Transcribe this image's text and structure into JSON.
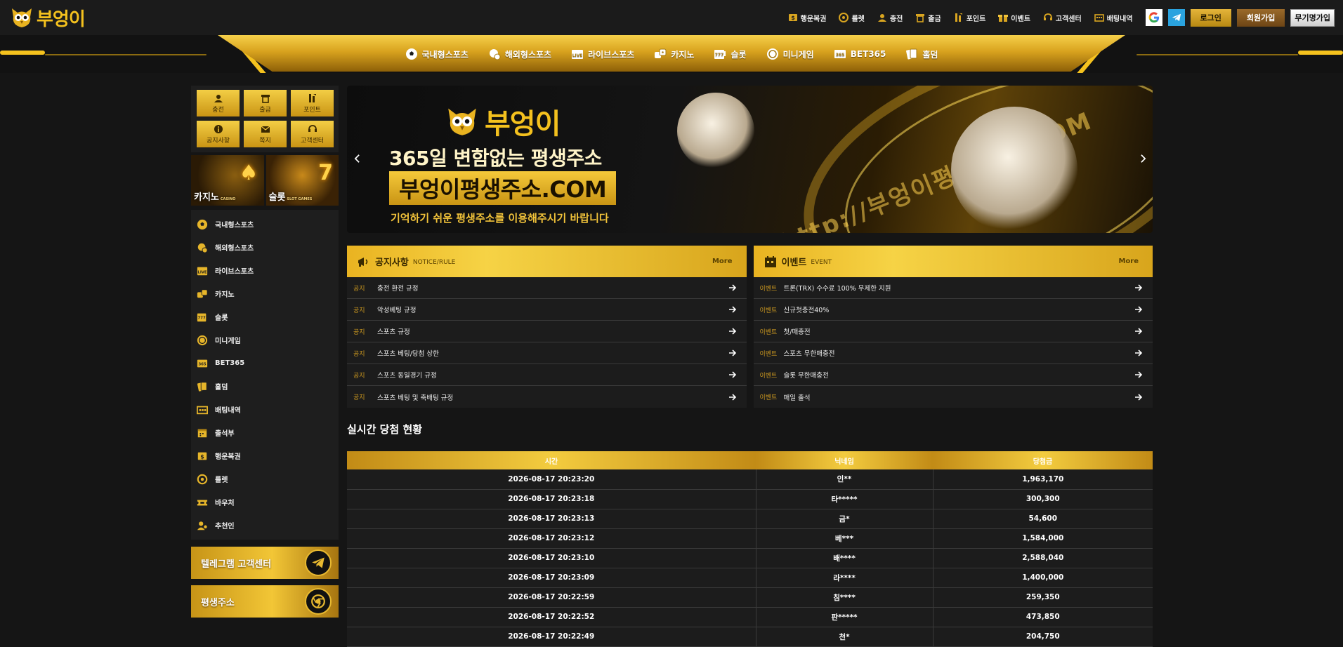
{
  "brand": {
    "name": "부엉이",
    "accent": "#f4c11e"
  },
  "header": {
    "menu": [
      {
        "label": "행운복권",
        "icon": "lottery-icon"
      },
      {
        "label": "룰렛",
        "icon": "roulette-icon"
      },
      {
        "label": "충전",
        "icon": "deposit-icon"
      },
      {
        "label": "출금",
        "icon": "withdraw-icon"
      },
      {
        "label": "포인트",
        "icon": "point-icon"
      },
      {
        "label": "이벤트",
        "icon": "gift-icon"
      },
      {
        "label": "고객센터",
        "icon": "support-icon"
      },
      {
        "label": "배팅내역",
        "icon": "history-icon"
      }
    ],
    "login_label": "로그인",
    "join_label": "회원가입",
    "free_label": "무기명가입"
  },
  "nav": [
    {
      "label": "국내형스포츠",
      "icon": "soccer-ball-icon"
    },
    {
      "label": "해외형스포츠",
      "icon": "globe-sports-icon"
    },
    {
      "label": "라이브스포츠",
      "icon": "live-icon"
    },
    {
      "label": "카지노",
      "icon": "casino-chip-icon"
    },
    {
      "label": "슬롯",
      "icon": "slot-icon"
    },
    {
      "label": "미니게임",
      "icon": "coin-icon"
    },
    {
      "label": "BET365",
      "icon": "bet365-icon"
    },
    {
      "label": "홀덤",
      "icon": "cards-icon"
    }
  ],
  "quick": [
    {
      "label": "충전",
      "icon": "deposit-icon"
    },
    {
      "label": "출금",
      "icon": "withdraw-icon"
    },
    {
      "label": "포인트",
      "icon": "point-icon"
    },
    {
      "label": "공지사항",
      "icon": "info-icon"
    },
    {
      "label": "쪽지",
      "icon": "mail-icon"
    },
    {
      "label": "고객센터",
      "icon": "support-icon"
    }
  ],
  "game_banners": [
    {
      "label": "카지노",
      "sub": "CASINO"
    },
    {
      "label": "슬롯",
      "sub": "SLOT GAMES"
    }
  ],
  "side_menu": [
    {
      "label": "국내형스포츠",
      "icon": "soccer-ball-icon"
    },
    {
      "label": "해외형스포츠",
      "icon": "globe-sports-icon"
    },
    {
      "label": "라이브스포츠",
      "icon": "live-icon"
    },
    {
      "label": "카지노",
      "icon": "casino-chip-icon"
    },
    {
      "label": "슬롯",
      "icon": "slot-icon"
    },
    {
      "label": "미니게임",
      "icon": "coin-icon"
    },
    {
      "label": "BET365",
      "icon": "bet365-icon"
    },
    {
      "label": "홀덤",
      "icon": "cards-icon"
    },
    {
      "label": "배팅내역",
      "icon": "history-icon"
    },
    {
      "label": "출석부",
      "icon": "calendar-icon"
    },
    {
      "label": "행운복권",
      "icon": "lottery-icon"
    },
    {
      "label": "룰렛",
      "icon": "roulette-icon"
    },
    {
      "label": "바우처",
      "icon": "voucher-icon"
    },
    {
      "label": "추천인",
      "icon": "referral-icon"
    }
  ],
  "promos": [
    {
      "label": "텔레그램 고객센터",
      "icon": "telegram-icon"
    },
    {
      "label": "평생주소",
      "icon": "chrome-icon"
    }
  ],
  "hero": {
    "logo_text": "부엉이",
    "line1": "365일 변함없는 평생주소",
    "box": "부엉이평생주소.COM",
    "line3": "기억하기 쉬운 평생주소를 이용해주시기 바랍니다",
    "art_url": "http://부엉이평생주소.COM"
  },
  "notice": {
    "title": "공지사항",
    "sub": "NOTICE/RULE",
    "more": "More",
    "rows": [
      {
        "tag": "공지",
        "text": "충전 환전 규정"
      },
      {
        "tag": "공지",
        "text": "악성베팅 규정"
      },
      {
        "tag": "공지",
        "text": "스포츠 규정"
      },
      {
        "tag": "공지",
        "text": "스포츠 베팅/당첨 상한"
      },
      {
        "tag": "공지",
        "text": "스포츠 동일경기 규정"
      },
      {
        "tag": "공지",
        "text": "스포츠 베팅 및 축배팅 규정"
      }
    ]
  },
  "event": {
    "title": "이벤트",
    "sub": "EVENT",
    "more": "More",
    "rows": [
      {
        "tag": "이벤트",
        "text": "트론(TRX) 수수료 100% 무제한 지원"
      },
      {
        "tag": "이벤트",
        "text": "신규첫충전40%"
      },
      {
        "tag": "이벤트",
        "text": "첫/매충전"
      },
      {
        "tag": "이벤트",
        "text": "스포츠 무한매충전"
      },
      {
        "tag": "이벤트",
        "text": "슬롯 무한매충전"
      },
      {
        "tag": "이벤트",
        "text": "매일 출석"
      }
    ]
  },
  "wins": {
    "title": "실시간 당첨 현황",
    "columns": [
      "시간",
      "닉네임",
      "당첨금"
    ],
    "rows": [
      [
        "2026-08-17 20:23:20",
        "인**",
        "1,963,170"
      ],
      [
        "2026-08-17 20:23:18",
        "타*****",
        "300,300"
      ],
      [
        "2026-08-17 20:23:13",
        "금*",
        "54,600"
      ],
      [
        "2026-08-17 20:23:12",
        "베***",
        "1,584,000"
      ],
      [
        "2026-08-17 20:23:10",
        "배****",
        "2,588,040"
      ],
      [
        "2026-08-17 20:23:09",
        "라****",
        "1,400,000"
      ],
      [
        "2026-08-17 20:22:59",
        "침****",
        "259,350"
      ],
      [
        "2026-08-17 20:22:52",
        "판*****",
        "473,850"
      ],
      [
        "2026-08-17 20:22:49",
        "천*",
        "204,750"
      ]
    ]
  }
}
